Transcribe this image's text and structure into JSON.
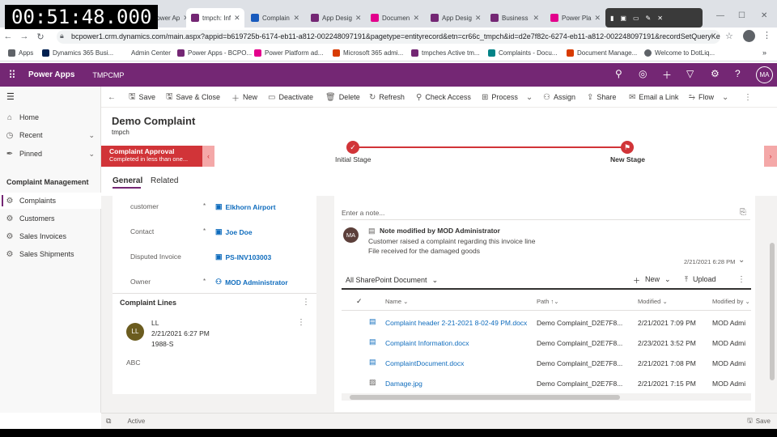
{
  "overlay": {
    "timer": "00:51:48.000"
  },
  "browser": {
    "tabs": [
      {
        "label": "Power Ap",
        "color": "#742774"
      },
      {
        "label": "tmpch: Inf",
        "color": "#742774"
      },
      {
        "label": "Complain",
        "color": "#185abd"
      },
      {
        "label": "App Desig",
        "color": "#742774"
      },
      {
        "label": "Documen",
        "color": "#e3008c"
      },
      {
        "label": "App Desig",
        "color": "#742774"
      },
      {
        "label": "Business",
        "color": "#742774"
      },
      {
        "label": "Power Pla",
        "color": "#e3008c"
      }
    ],
    "url": "bcpower1.crm.dynamics.com/main.aspx?appid=b619725b-6174-eb11-a812-002248097191&pagetype=entityrecord&etn=cr66c_tmpch&id=d2e7f82c-6274-eb11-a812-002248097191&recordSetQueryKey=...",
    "bookmarks": [
      "Apps",
      "Dynamics 365 Busi...",
      "Admin Center",
      "Power Apps - BCPO...",
      "Power Platform ad...",
      "Microsoft 365 admi...",
      "tmpches Active tm...",
      "Complaints - Docu...",
      "Document Manage...",
      "Welcome to DotLiq..."
    ]
  },
  "app": {
    "name": "Power Apps",
    "env": "TMPCMP",
    "avatar": "MA"
  },
  "sitemap": {
    "items": [
      {
        "label": "Home",
        "icon": "home-icon"
      },
      {
        "label": "Recent",
        "icon": "clock-icon"
      },
      {
        "label": "Pinned",
        "icon": "pin-icon"
      }
    ],
    "group": "Complaint Management",
    "entities": [
      "Complaints",
      "Customers",
      "Sales Invoices",
      "Sales Shipments"
    ]
  },
  "commands": [
    "Save",
    "Save & Close",
    "New",
    "Deactivate",
    "Delete",
    "Refresh",
    "Check Access",
    "Process",
    "Assign",
    "Share",
    "Email a Link",
    "Flow"
  ],
  "form": {
    "title": "Demo Complaint",
    "entity": "tmpch",
    "bpf": {
      "active_title": "Complaint Approval",
      "active_sub": "Completed in less than one...",
      "stage1": "Initial Stage",
      "stage2": "New Stage"
    },
    "tabs": [
      "General",
      "Related"
    ],
    "fields": [
      {
        "label": "customer",
        "req": "*",
        "value": "Elkhorn Airport"
      },
      {
        "label": "Contact",
        "req": "*",
        "value": "Joe Doe"
      },
      {
        "label": "Disputed Invoice",
        "req": "",
        "value": "PS-INV103003"
      },
      {
        "label": "Owner",
        "req": "*",
        "value": "MOD Administrator"
      }
    ],
    "subgrid": {
      "title": "Complaint Lines",
      "item": {
        "initials": "LL",
        "name": "LL",
        "date": "2/21/2021 6:27 PM",
        "code": "1988-S"
      },
      "footer": "ABC"
    }
  },
  "timeline": {
    "placeholder": "Enter a note...",
    "note": {
      "initials": "MA",
      "title": "Note modified by MOD Administrator",
      "line1": "Customer raised a complaint regarding this invoice line",
      "line2": "File received for the damaged goods",
      "time": "2/21/2021 6:28 PM"
    }
  },
  "sharepoint": {
    "view": "All SharePoint Document",
    "new_label": "New",
    "upload_label": "Upload",
    "columns": [
      "Name",
      "Path",
      "Modified",
      "Modified by"
    ],
    "rows": [
      {
        "name": "Complaint header 2-21-2021 8-02-49 PM.docx",
        "path": "Demo Complaint_D2E7F8...",
        "modified": "2/21/2021 7:09 PM",
        "by": "MOD Admi"
      },
      {
        "name": "Complaint Information.docx",
        "path": "Demo Complaint_D2E7F8...",
        "modified": "2/23/2021 3:52 PM",
        "by": "MOD Admi"
      },
      {
        "name": "ComplaintDocument.docx",
        "path": "Demo Complaint_D2E7F8...",
        "modified": "2/21/2021 7:08 PM",
        "by": "MOD Admi"
      },
      {
        "name": "Damage.jpg",
        "path": "Demo Complaint_D2E7F8...",
        "modified": "2/21/2021 7:15 PM",
        "by": "MOD Admi"
      }
    ]
  },
  "footer": {
    "status": "Active",
    "save": "Save"
  }
}
